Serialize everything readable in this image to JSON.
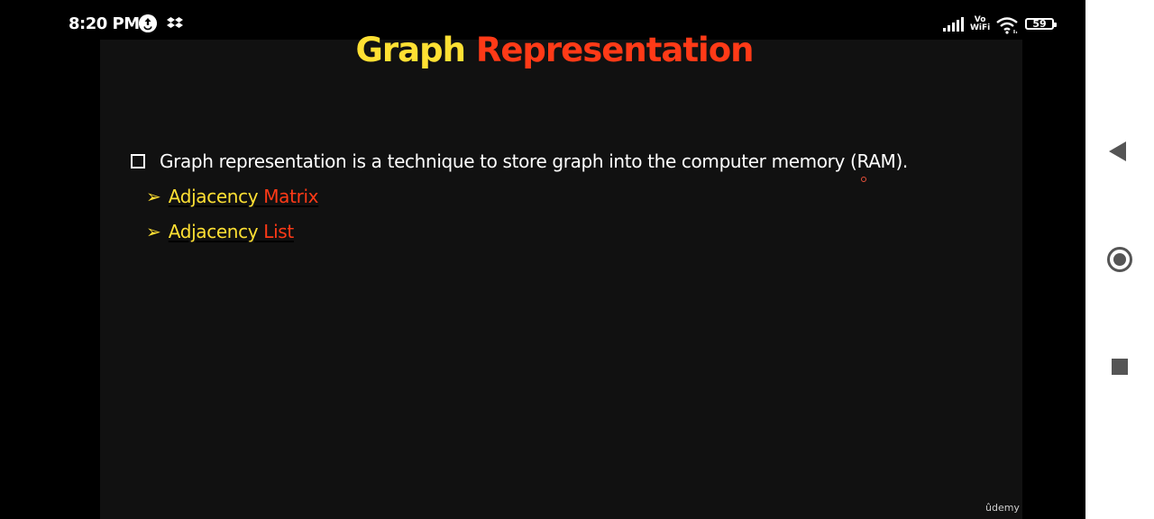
{
  "status_bar": {
    "time": "8:20 PM",
    "icons": [
      "updates-icon",
      "dropbox-icon",
      "signal-icon",
      "vowifi-icon",
      "wifi-icon",
      "battery-icon"
    ],
    "vowifi_top": "Vo",
    "vowifi_bottom": "WiFi",
    "battery": "59"
  },
  "slide": {
    "title_part1": "Graph",
    "title_part2": "Representation",
    "bullet": "Graph representation is a technique to store graph into the computer memory (RAM).",
    "sub_items": [
      {
        "part1": "Adjacency",
        "part2": " Matrix"
      },
      {
        "part1": "Adjacency",
        "part2": " List"
      }
    ],
    "watermark": "ûdemy"
  },
  "nav_bar": {
    "buttons": [
      "back-icon",
      "home-icon",
      "recents-icon"
    ]
  },
  "colors": {
    "title_yellow": "#ffe033",
    "title_red": "#ff3a17",
    "slide_background": "#111111",
    "nav_background": "#ffffff",
    "nav_icon": "#555555"
  }
}
